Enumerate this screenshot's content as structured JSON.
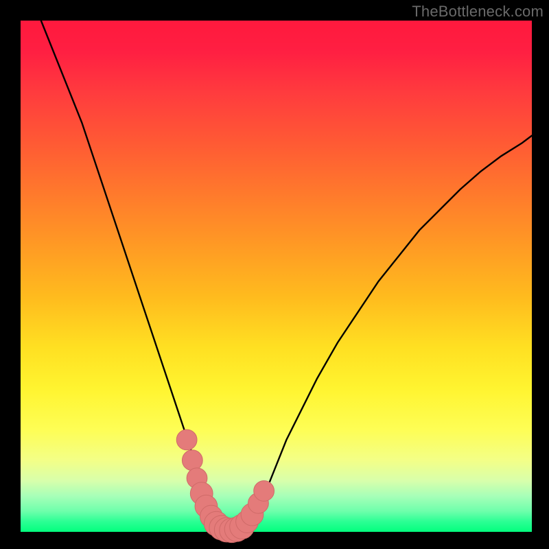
{
  "watermark": "TheBottleneck.com",
  "colors": {
    "frame": "#000000",
    "curve_stroke": "#000000",
    "marker_fill": "#e47b7a",
    "marker_stroke": "#cf6a68"
  },
  "chart_data": {
    "type": "line",
    "title": "",
    "xlabel": "",
    "ylabel": "",
    "xlim": [
      0,
      100
    ],
    "ylim": [
      0,
      100
    ],
    "grid": false,
    "legend": false,
    "series": [
      {
        "name": "bottleneck-curve",
        "x": [
          4,
          6,
          8,
          10,
          12,
          14,
          16,
          18,
          20,
          22,
          24,
          26,
          28,
          30,
          32,
          33,
          34,
          35,
          36,
          37,
          38,
          39,
          40,
          41,
          42,
          43,
          44,
          46,
          48,
          50,
          52,
          55,
          58,
          62,
          66,
          70,
          74,
          78,
          82,
          86,
          90,
          94,
          98,
          100
        ],
        "y": [
          100,
          95,
          90,
          85,
          80,
          74,
          68,
          62,
          56,
          50,
          44,
          38,
          32,
          26,
          20,
          17,
          14,
          11,
          8,
          5,
          3,
          1.5,
          0.6,
          0.2,
          0.2,
          0.6,
          1.5,
          4,
          8,
          13,
          18,
          24,
          30,
          37,
          43,
          49,
          54,
          59,
          63,
          67,
          70.5,
          73.5,
          76,
          77.5
        ]
      }
    ],
    "markers": [
      {
        "x": 32.5,
        "y": 18,
        "r": 2.0
      },
      {
        "x": 33.6,
        "y": 14,
        "r": 2.0
      },
      {
        "x": 34.5,
        "y": 10.5,
        "r": 2.0
      },
      {
        "x": 35.4,
        "y": 7.5,
        "r": 2.2
      },
      {
        "x": 36.3,
        "y": 5.0,
        "r": 2.2
      },
      {
        "x": 37.3,
        "y": 3.0,
        "r": 2.2
      },
      {
        "x": 38.3,
        "y": 1.6,
        "r": 2.4
      },
      {
        "x": 39.3,
        "y": 0.8,
        "r": 2.4
      },
      {
        "x": 40.3,
        "y": 0.4,
        "r": 2.4
      },
      {
        "x": 41.3,
        "y": 0.3,
        "r": 2.4
      },
      {
        "x": 42.3,
        "y": 0.5,
        "r": 2.4
      },
      {
        "x": 43.3,
        "y": 1.0,
        "r": 2.4
      },
      {
        "x": 44.3,
        "y": 2.0,
        "r": 2.2
      },
      {
        "x": 45.3,
        "y": 3.4,
        "r": 2.2
      },
      {
        "x": 46.5,
        "y": 5.6,
        "r": 2.0
      },
      {
        "x": 47.6,
        "y": 8.0,
        "r": 2.0
      }
    ]
  }
}
